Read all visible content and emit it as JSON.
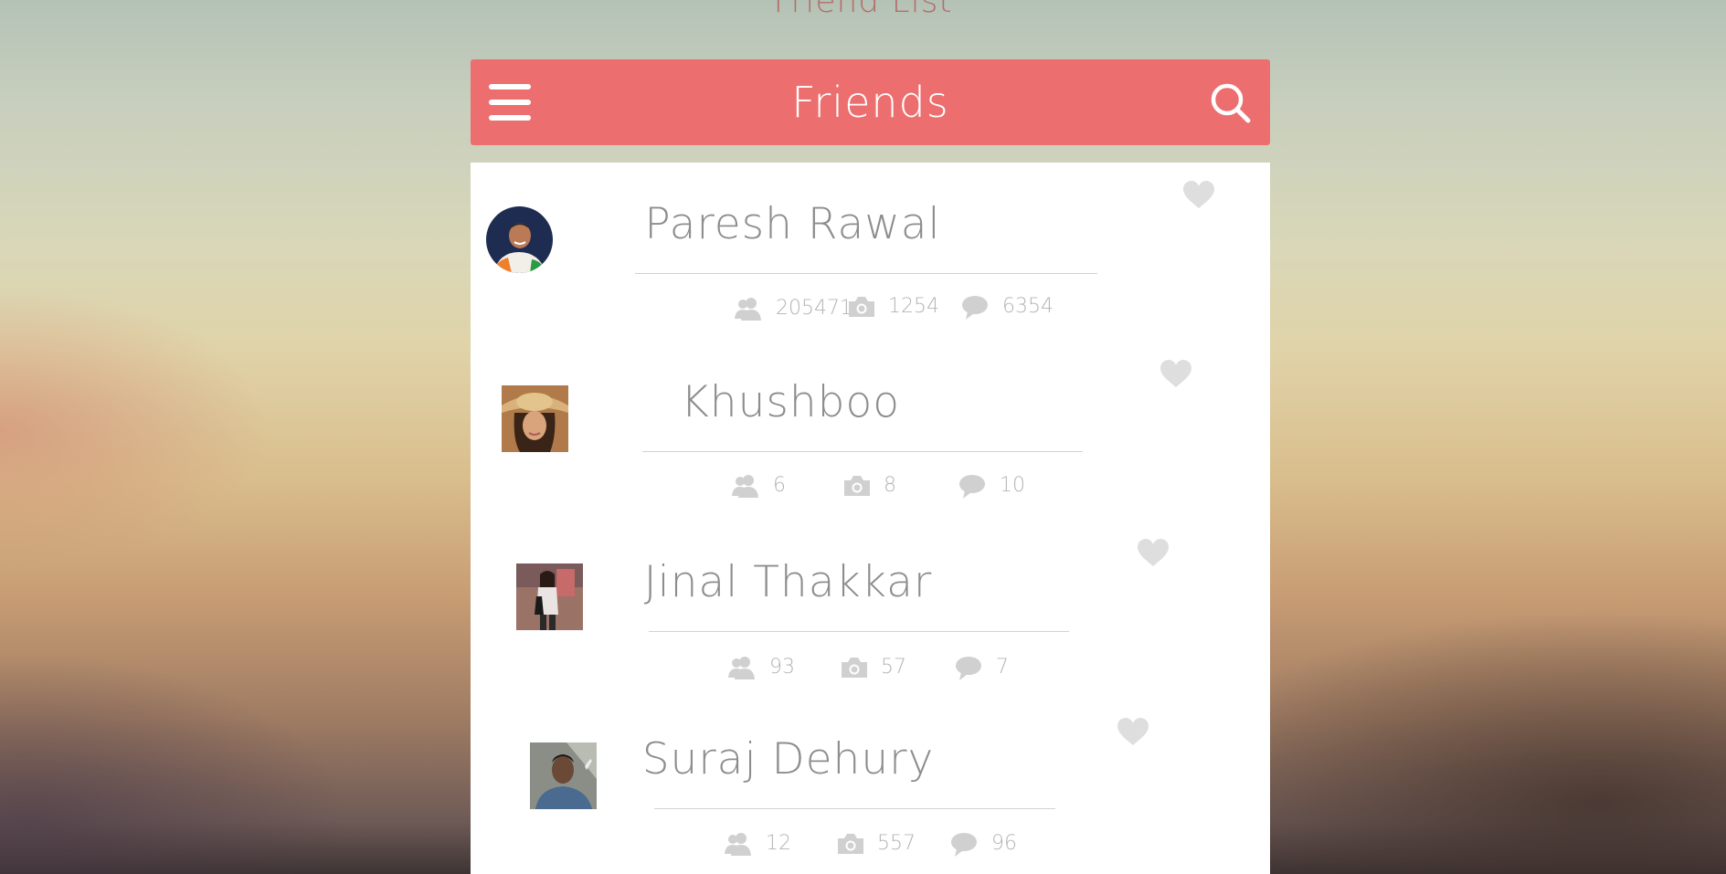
{
  "page": {
    "title": "Friend List"
  },
  "header": {
    "title": "Friends",
    "menu_icon": "hamburger-menu-icon",
    "search_icon": "search-icon"
  },
  "colors": {
    "accent": "#ed6e6f",
    "text_muted": "#8d8d8d",
    "icon_gray": "#d0d0d0"
  },
  "friends": [
    {
      "name": "Paresh Rawal",
      "followers": "2054714",
      "photos": "1254",
      "comments": "6354"
    },
    {
      "name": "Khushboo",
      "followers": "6",
      "photos": "8",
      "comments": "10"
    },
    {
      "name": "Jinal Thakkar",
      "followers": "93",
      "photos": "57",
      "comments": "7"
    },
    {
      "name": "Suraj Dehury",
      "followers": "12",
      "photos": "557",
      "comments": "96"
    }
  ]
}
